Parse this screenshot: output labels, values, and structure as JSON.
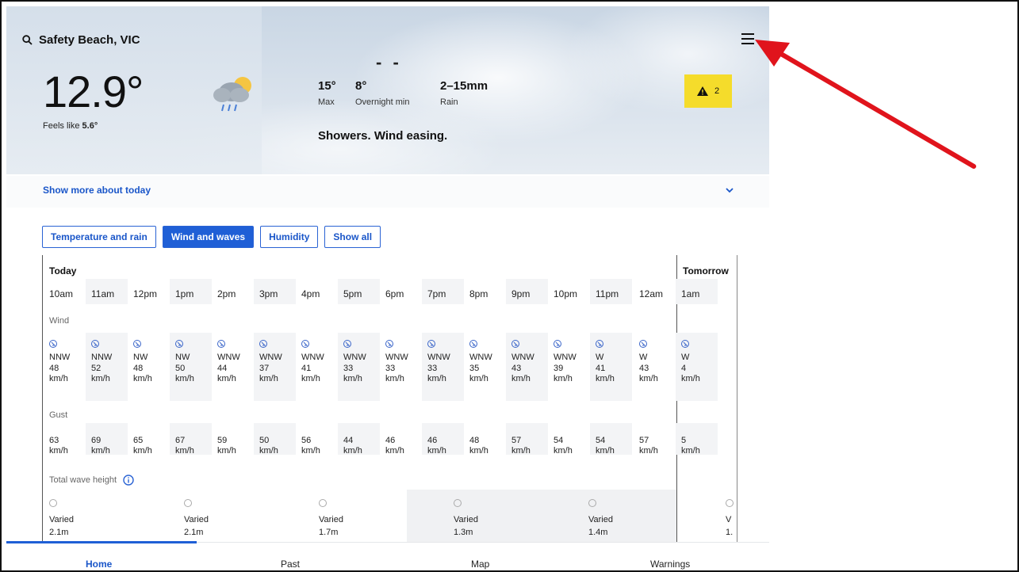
{
  "location": {
    "name": "Safety Beach, VIC"
  },
  "current": {
    "temp": "12.9°",
    "feels_like_prefix": "Feels like ",
    "feels_like_value": "5.6°",
    "icon": "showers-icon"
  },
  "forecast": {
    "dashes": "- -",
    "max_value": "15°",
    "max_label": "Max",
    "min_value": "8°",
    "min_label": "Overnight min",
    "rain_value": "2–15mm",
    "rain_label": "Rain",
    "summary": "Showers. Wind easing."
  },
  "warnings": {
    "count": "2",
    "color": "#f5dc2b"
  },
  "show_more": {
    "label": "Show more about today"
  },
  "filters": [
    {
      "label": "Temperature and rain",
      "active": false
    },
    {
      "label": "Wind and waves",
      "active": true
    },
    {
      "label": "Humidity",
      "active": false
    },
    {
      "label": "Show all",
      "active": false
    }
  ],
  "table": {
    "days": {
      "today": "Today",
      "tomorrow": "Tomorrow"
    },
    "hours": [
      "10am",
      "11am",
      "12pm",
      "1pm",
      "2pm",
      "3pm",
      "4pm",
      "5pm",
      "6pm",
      "7pm",
      "8pm",
      "9pm",
      "10pm",
      "11pm",
      "12am",
      "1am"
    ],
    "wind_label": "Wind",
    "wind_dir": [
      "NNW",
      "NNW",
      "NW",
      "NW",
      "WNW",
      "WNW",
      "WNW",
      "WNW",
      "WNW",
      "WNW",
      "WNW",
      "WNW",
      "WNW",
      "W",
      "W",
      "W"
    ],
    "wind_speed": [
      "48",
      "52",
      "48",
      "50",
      "44",
      "37",
      "41",
      "33",
      "33",
      "33",
      "35",
      "43",
      "39",
      "41",
      "43",
      "4"
    ],
    "unit": "km/h",
    "gust_label": "Gust",
    "gust": [
      "63",
      "69",
      "65",
      "67",
      "59",
      "50",
      "56",
      "44",
      "46",
      "46",
      "48",
      "57",
      "54",
      "54",
      "57",
      "5"
    ],
    "wave_label": "Total wave height",
    "waves": [
      {
        "type": "Varied",
        "height": "2.1m"
      },
      {
        "type": "Varied",
        "height": "2.1m"
      },
      {
        "type": "Varied",
        "height": "1.7m"
      },
      {
        "type": "Varied",
        "height": "1.3m"
      },
      {
        "type": "Varied",
        "height": "1.4m"
      },
      {
        "type": "V",
        "height": "1."
      }
    ]
  },
  "nav": {
    "home": "Home",
    "past": "Past",
    "map": "Map",
    "warnings": "Warnings"
  },
  "colors": {
    "accent": "#1f5fd6",
    "annotation": "#e0141c"
  }
}
